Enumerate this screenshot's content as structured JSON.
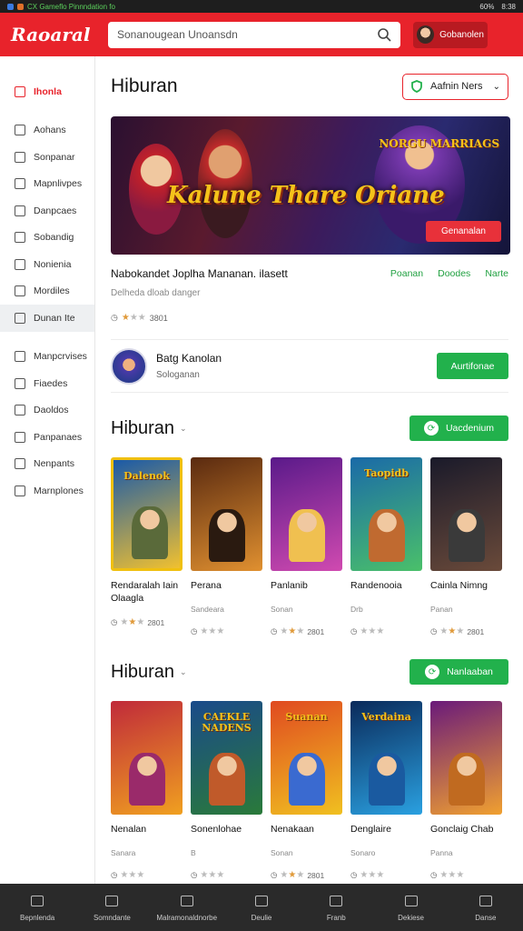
{
  "statusbar": {
    "notification": "CX Gameflo Pinnndation fo",
    "battery": "60%",
    "time": "8:38"
  },
  "header": {
    "logo": "Raoaral",
    "search_placeholder": "Sonanougean Unoansdn",
    "user_label": "Gobanolen"
  },
  "sidebar": {
    "items": [
      {
        "label": "Ihonla",
        "icon": "home-icon",
        "active": true
      },
      {
        "label": "Aohans",
        "icon": "grid-icon"
      },
      {
        "label": "Sonpanar",
        "icon": "chart-icon"
      },
      {
        "label": "Mapnlivpes",
        "icon": "clock-icon"
      },
      {
        "label": "Danpcaes",
        "icon": "tag-icon"
      },
      {
        "label": "Sobandig",
        "icon": "user-icon"
      },
      {
        "label": "Nonienia",
        "icon": "building-icon"
      },
      {
        "label": "Mordiles",
        "icon": "camera-icon"
      },
      {
        "label": "Dunan Ite",
        "icon": "gamepad-icon",
        "highlight": true
      },
      {
        "label": "Manpcrvises",
        "icon": "list-icon"
      },
      {
        "label": "Fiaedes",
        "icon": "globe-icon"
      },
      {
        "label": "Daoldos",
        "icon": "download-icon"
      },
      {
        "label": "Panpanaes",
        "icon": "doc-icon"
      },
      {
        "label": "Nenpants",
        "icon": "shield-icon"
      },
      {
        "label": "Marnplones",
        "icon": "people-icon"
      }
    ]
  },
  "page": {
    "title": "Hiburan",
    "filter": "Aafnin Ners",
    "hero": {
      "title": "Kalune Thare Oriane",
      "badge": "NORGU MARRIAGS",
      "button": "Genanalan"
    },
    "featured": {
      "title": "Nabokandet Joplha Mananan. ilasett",
      "subtitle": "Delheda dloab danger",
      "links": [
        "Poanan",
        "Doodes",
        "Narte"
      ],
      "rating_text": "3801",
      "rating_stars": 3
    },
    "developer": {
      "name": "Batg Kanolan",
      "subtitle": "Sologanan",
      "button": "Aurtifonae"
    }
  },
  "sections": [
    {
      "title": "Hiburan",
      "button": "Uacdenium",
      "games": [
        {
          "name": "Rendaralah Iain Olaagla",
          "sub": "",
          "rating": "2801",
          "thumb_title": "Dalenok",
          "c1": "#1a5aa8",
          "c2": "#f0c030",
          "fig": "#5a6a3a",
          "selected": true
        },
        {
          "name": "Perana",
          "sub": "Sandeara",
          "rating": "",
          "thumb_title": "",
          "c1": "#5a2a10",
          "c2": "#e09030",
          "fig": "#2a1a10"
        },
        {
          "name": "Panlanib",
          "sub": "Sonan",
          "rating": "2801",
          "thumb_title": "",
          "c1": "#5a1a8a",
          "c2": "#d04ab0",
          "fig": "#f0c050"
        },
        {
          "name": "Randenooia",
          "sub": "Drb",
          "rating": "",
          "thumb_title": "Taopidb",
          "c1": "#1a6aa8",
          "c2": "#4ac06a",
          "fig": "#c06a30"
        },
        {
          "name": "Cainla Nimng",
          "sub": "Panan",
          "rating": "2801",
          "thumb_title": "",
          "c1": "#1a1a2a",
          "c2": "#6a4a3a",
          "fig": "#3a3a3a"
        }
      ]
    },
    {
      "title": "Hiburan",
      "button": "Nanlaaban",
      "games": [
        {
          "name": "Nenalan",
          "sub": "Sanara",
          "rating": "",
          "thumb_title": "",
          "c1": "#c02a3a",
          "c2": "#f0a020",
          "fig": "#9a2a6a"
        },
        {
          "name": "Sonenlohae",
          "sub": "B",
          "rating": "",
          "thumb_title": "CAEKLE NADENS",
          "c1": "#1a4a8a",
          "c2": "#2a7a3a",
          "fig": "#c05a2a"
        },
        {
          "name": "Nenakaan",
          "sub": "Sonan",
          "rating": "2801",
          "thumb_title": "Suanan",
          "c1": "#e04a20",
          "c2": "#f0c020",
          "fig": "#3a6ad0"
        },
        {
          "name": "Denglaire",
          "sub": "Sonaro",
          "rating": "",
          "thumb_title": "Verdaina",
          "c1": "#0a2a5a",
          "c2": "#2aa0e0",
          "fig": "#1a5aa0"
        },
        {
          "name": "Gonclaig Chab",
          "sub": "Panna",
          "rating": "",
          "thumb_title": "",
          "c1": "#6a1a7a",
          "c2": "#f0a030",
          "fig": "#c06a20"
        }
      ]
    }
  ],
  "bottombar": {
    "items": [
      {
        "label": "Bepnlenda",
        "icon": "home-icon"
      },
      {
        "label": "Somndante",
        "icon": "house-icon"
      },
      {
        "label": "Malramonaldnorbe",
        "icon": "globe-icon"
      },
      {
        "label": "Deulie",
        "icon": "flag-icon"
      },
      {
        "label": "Franb",
        "icon": "bag-icon"
      },
      {
        "label": "Dekiese",
        "icon": "mail-icon"
      },
      {
        "label": "Danse",
        "icon": "play-icon"
      }
    ]
  }
}
